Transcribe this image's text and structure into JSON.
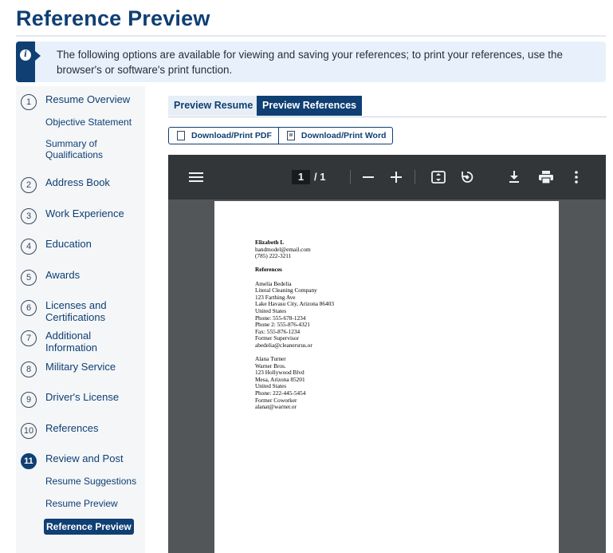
{
  "page_title": "Reference Preview",
  "info_text": "The following options are available for viewing and saving your references; to print your references, use the browser's or software's print function.",
  "sidebar": {
    "steps": [
      {
        "num": "1",
        "label": "Resume Overview"
      },
      {
        "num": "2",
        "label": "Address Book"
      },
      {
        "num": "3",
        "label": "Work Experience"
      },
      {
        "num": "4",
        "label": "Education"
      },
      {
        "num": "5",
        "label": "Awards"
      },
      {
        "num": "6",
        "label": "Licenses and Certifications"
      },
      {
        "num": "7",
        "label": "Additional Information"
      },
      {
        "num": "8",
        "label": "Military Service"
      },
      {
        "num": "9",
        "label": "Driver's License"
      },
      {
        "num": "10",
        "label": "References"
      },
      {
        "num": "11",
        "label": "Review and Post"
      }
    ],
    "subs": {
      "objective": "Objective Statement",
      "summary": "Summary of Qualifications",
      "suggestions": "Resume Suggestions",
      "resume_preview": "Resume Preview",
      "reference_preview": "Reference Preview"
    }
  },
  "tabs": {
    "preview_resume": "Preview Resume",
    "preview_references": "Preview References"
  },
  "download": {
    "pdf": "Download/Print PDF",
    "word": "Download/Print Word"
  },
  "viewer": {
    "current_page": "1",
    "page_of": "/  1"
  },
  "document": {
    "name": "Elizabeth L",
    "email": "handmodel@email.com",
    "phone": "(785) 222-3211",
    "heading": "References",
    "ref1": [
      "Amelia Bedelia",
      "Literal Cleaning Company",
      "123 Farthing Ave",
      "Lake Havasu City, Arizona 86403",
      "United States",
      "Phone: 555-678-1234",
      "Phone 2: 555-876-4321",
      "Fax: 555-876-1234",
      "Former Supervisor",
      "abedelia@cleanersrus.or"
    ],
    "ref2": [
      "Alana Turner",
      "Warner Bros.",
      "123 Hollywood Blvd",
      "Mesa, Arizona 85201",
      "United States",
      "Phone: 222-445-5454",
      "Former Coworker",
      "alanat@warner.or"
    ]
  }
}
